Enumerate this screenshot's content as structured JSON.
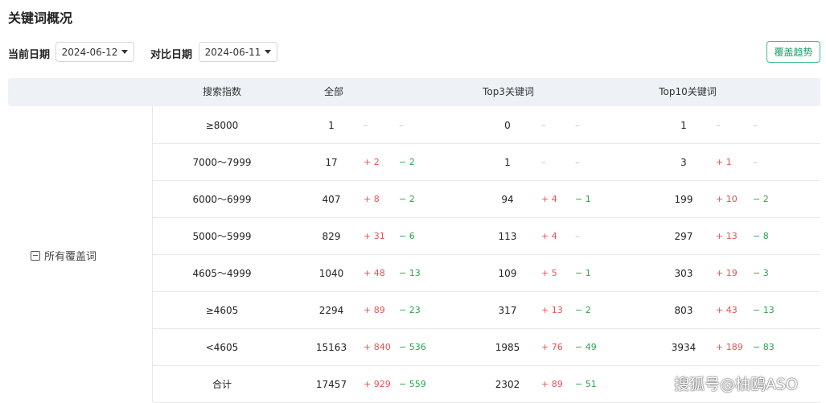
{
  "title": "关键词概况",
  "filters": {
    "current_label": "当前日期",
    "current_date": "2024-06-12",
    "compare_label": "对比日期",
    "compare_date": "2024-06-11",
    "trend_button": "覆盖趋势"
  },
  "table": {
    "headers": [
      "搜索指数",
      "全部",
      "Top3关键词",
      "Top10关键词"
    ],
    "group_label": "所有覆盖词",
    "rows": [
      {
        "range": "≥8000",
        "all": {
          "v": "1",
          "up": "–",
          "down": "–"
        },
        "top3": {
          "v": "0",
          "up": "–",
          "down": "–"
        },
        "top10": {
          "v": "1",
          "up": "–",
          "down": "–"
        }
      },
      {
        "range": "7000～7999",
        "all": {
          "v": "17",
          "up": "+ 2",
          "down": "− 2"
        },
        "top3": {
          "v": "1",
          "up": "–",
          "down": "–"
        },
        "top10": {
          "v": "3",
          "up": "+ 1",
          "down": "–"
        }
      },
      {
        "range": "6000～6999",
        "all": {
          "v": "407",
          "up": "+ 8",
          "down": "− 2"
        },
        "top3": {
          "v": "94",
          "up": "+ 4",
          "down": "− 1"
        },
        "top10": {
          "v": "199",
          "up": "+ 10",
          "down": "− 2"
        }
      },
      {
        "range": "5000～5999",
        "all": {
          "v": "829",
          "up": "+ 31",
          "down": "− 6"
        },
        "top3": {
          "v": "113",
          "up": "+ 4",
          "down": "–"
        },
        "top10": {
          "v": "297",
          "up": "+ 13",
          "down": "− 8"
        }
      },
      {
        "range": "4605～4999",
        "all": {
          "v": "1040",
          "up": "+ 48",
          "down": "− 13"
        },
        "top3": {
          "v": "109",
          "up": "+ 5",
          "down": "− 1"
        },
        "top10": {
          "v": "303",
          "up": "+ 19",
          "down": "− 3"
        }
      },
      {
        "range": "≥4605",
        "all": {
          "v": "2294",
          "up": "+ 89",
          "down": "− 23"
        },
        "top3": {
          "v": "317",
          "up": "+ 13",
          "down": "− 2"
        },
        "top10": {
          "v": "803",
          "up": "+ 43",
          "down": "− 13"
        }
      },
      {
        "range": "<4605",
        "all": {
          "v": "15163",
          "up": "+ 840",
          "down": "− 536"
        },
        "top3": {
          "v": "1985",
          "up": "+ 76",
          "down": "− 49"
        },
        "top10": {
          "v": "3934",
          "up": "+ 189",
          "down": "− 83"
        }
      },
      {
        "range": "合计",
        "all": {
          "v": "17457",
          "up": "+ 929",
          "down": "− 559"
        },
        "top3": {
          "v": "2302",
          "up": "+ 89",
          "down": "− 51"
        },
        "top10": {
          "v": "",
          "up": "",
          "down": ""
        }
      }
    ]
  },
  "watermark": "搜狐号@柚鸥ASO",
  "colors": {
    "up": "#e85050",
    "down": "#2aa44a",
    "accent": "#17a06a",
    "header_bg": "#eef1f5"
  }
}
